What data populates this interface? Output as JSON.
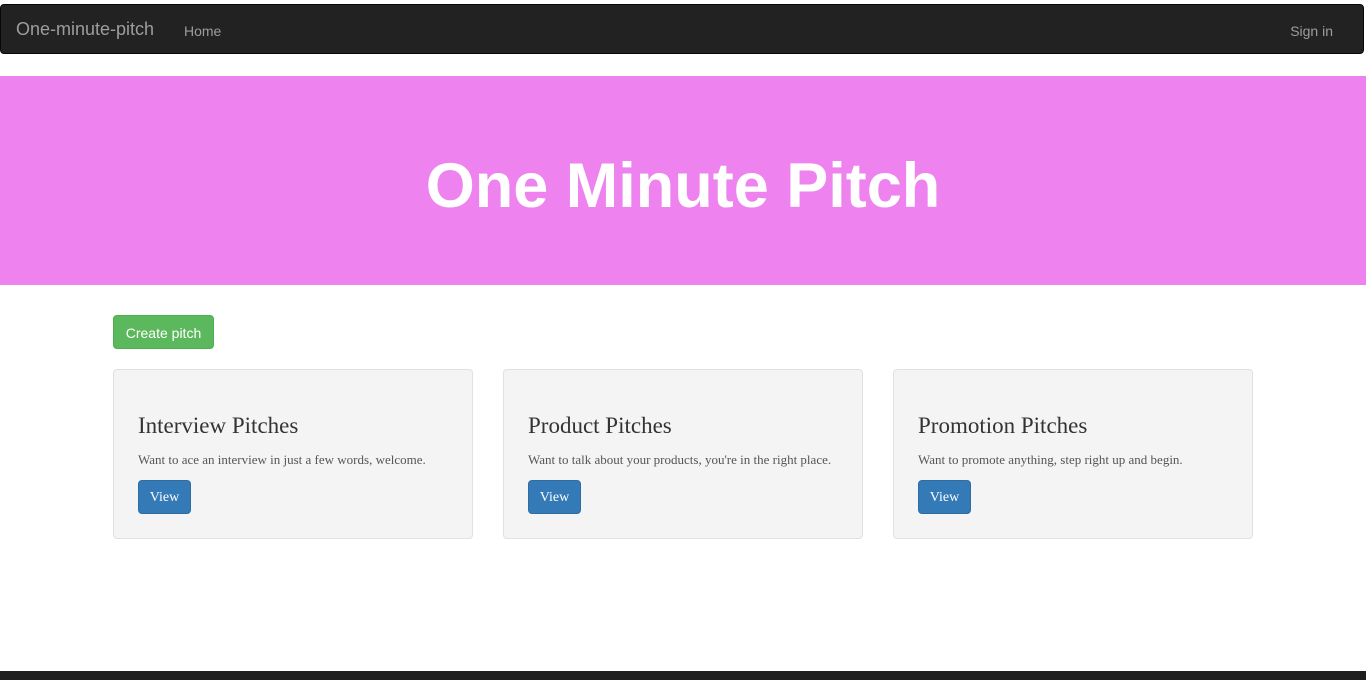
{
  "navbar": {
    "brand": "One-minute-pitch",
    "home_label": "Home",
    "signin_label": "Sign in"
  },
  "jumbotron": {
    "title": "One Minute Pitch"
  },
  "actions": {
    "create_label": "Create pitch"
  },
  "categories": [
    {
      "title": "Interview Pitches",
      "description": "Want to ace an interview in just a few words, welcome.",
      "button_label": "View"
    },
    {
      "title": "Product Pitches",
      "description": "Want to talk about your products, you're in the right place.",
      "button_label": "View"
    },
    {
      "title": "Promotion Pitches",
      "description": "Want to promote anything, step right up and begin.",
      "button_label": "View"
    }
  ],
  "colors": {
    "navbar_bg": "#222222",
    "jumbotron_bg": "#ee82ee",
    "success": "#5cb85c",
    "primary": "#337ab7",
    "card_bg": "#f4f4f4"
  }
}
